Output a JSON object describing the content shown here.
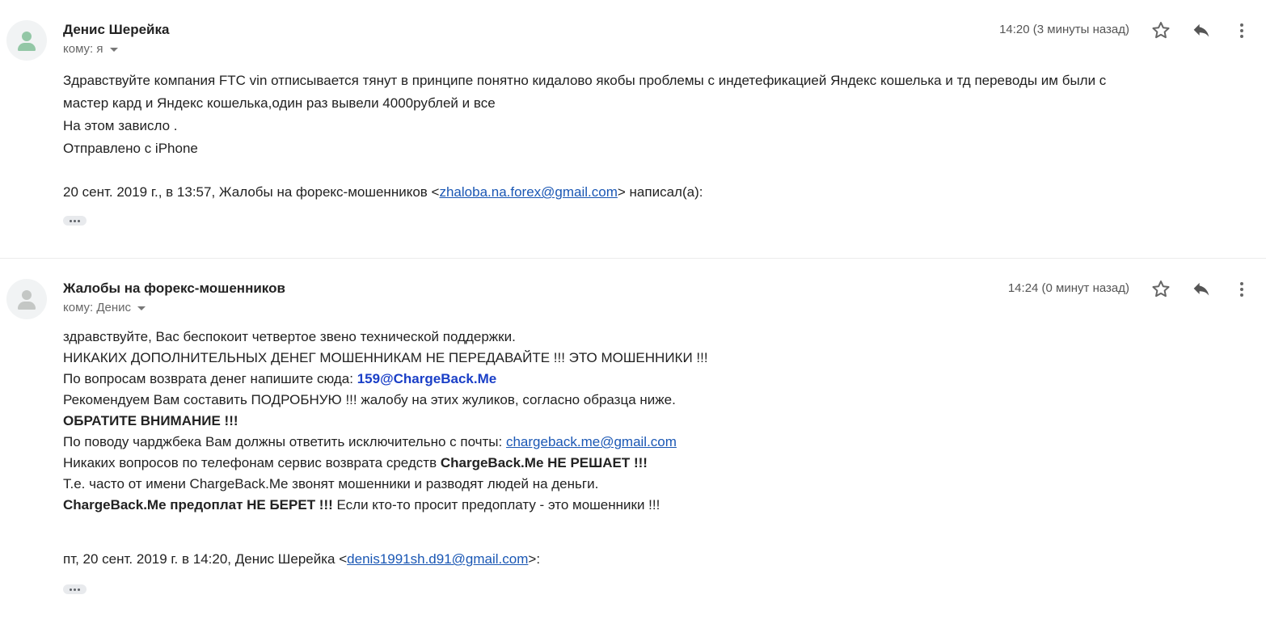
{
  "messages": [
    {
      "sender": "Денис Шерейка",
      "to_label": "кому: я",
      "time": "14:20 (3 минуты назад)",
      "body": [
        "Здравствуйте компания FTC vin отписывается тянут в принципе понятно кидалово якобы проблемы с индетефикацией Яндекс кошелька и тд переводы им были с",
        "мастер кард и Яндекс кошелька,один раз вывели 4000рублей и все",
        "На этом зависло .",
        "Отправлено с iPhone"
      ],
      "quote": {
        "prefix": "20 сент. 2019 г., в 13:57, Жалобы на форекс-мошенников <",
        "email": "zhaloba.na.forex@gmail.com",
        "suffix": "> написал(а):"
      }
    },
    {
      "sender": "Жалобы на форекс-мошенников",
      "to_label": "кому: Денис",
      "time": "14:24 (0 минут назад)",
      "body": {
        "l1": "здравствуйте, Вас беспокоит четвертое звено технической поддержки.",
        "l2": "НИКАКИХ ДОПОЛНИТЕЛЬНЫХ ДЕНЕГ МОШЕННИКАМ НЕ ПЕРЕДАВАЙТЕ !!! ЭТО МОШЕННИКИ !!!",
        "l3_text": "По вопросам возврата денег напишите сюда: ",
        "l3_contact": "159@ChargeBack.Me",
        "l4": "Рекомендуем Вам составить ПОДРОБНУЮ !!! жалобу на этих жуликов, согласно образца ниже.",
        "l5": "ОБРАТИТЕ ВНИМАНИЕ !!!",
        "l6_text": "По поводу чарджбека Вам должны ответить исключительно с почты: ",
        "l6_email": "chargeback.me@gmail.com",
        "l7_text": "Никаких вопросов по телефонам сервис возврата средств ",
        "l7_bold": "ChargeBack.Me НЕ РЕШАЕТ !!!",
        "l8": "Т.е. часто от имени ChargeBack.Me звонят мошенники и разводят людей на деньги.",
        "l9_bold": "ChargeBack.Me предоплат НЕ БЕРЕТ !!!",
        "l9_text": " Если кто-то просит предоплату - это мошенники !!!"
      },
      "quote": {
        "prefix": "пт, 20 сент. 2019 г. в 14:20, Денис Шерейка <",
        "email": "denis1991sh.d91@gmail.com",
        "suffix": ">:"
      }
    }
  ],
  "icons": {
    "star": "star-icon",
    "reply": "reply-icon",
    "more": "more-vert-icon",
    "avatar": "person-icon",
    "expand": "more-horiz-icon"
  },
  "colors": {
    "link": "#1a57b4",
    "contact": "#1a3fc7",
    "avatar_sender1": "#93c7a6",
    "avatar_sender2": "#c4c7c5"
  }
}
